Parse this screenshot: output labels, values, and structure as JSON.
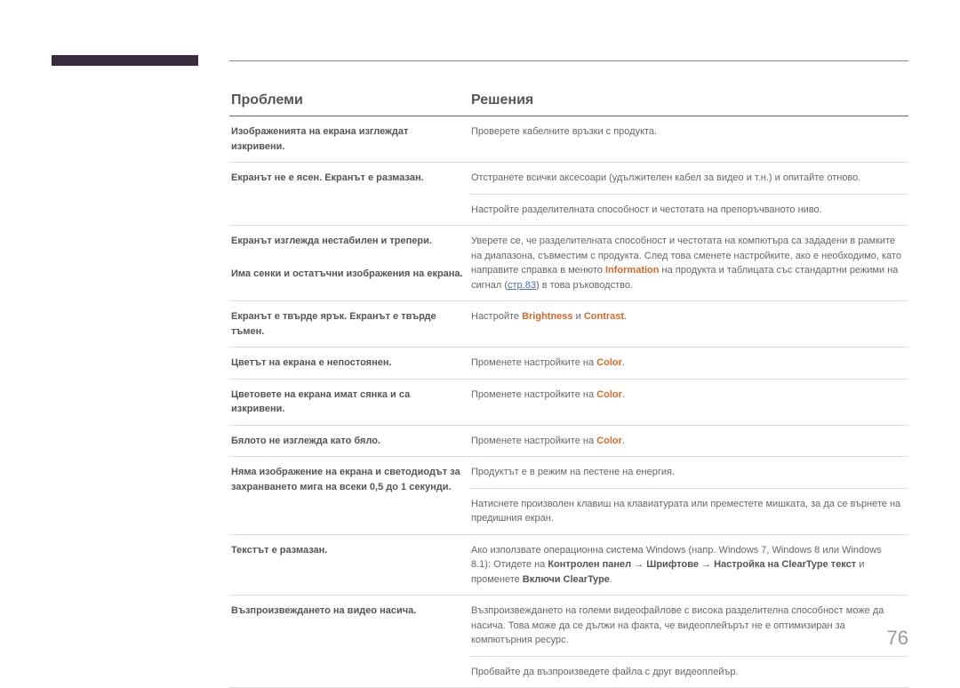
{
  "page_number": "76",
  "headers": {
    "problem": "Проблеми",
    "solution": "Решения"
  },
  "page_ref": {
    "prefix": "стр.",
    "num": "83"
  },
  "hl": {
    "information": "Information",
    "brightness": "Brightness",
    "contrast": "Contrast",
    "color": "Color"
  },
  "bold": {
    "control_panel": "Контролен панел",
    "fonts": "Шрифтове",
    "cleartype_setting": "Настройка на ClearType текст",
    "enable_cleartype": "Включи ClearType"
  },
  "rows": {
    "r1": {
      "p": "Изображенията на екрана изглеждат изкривени.",
      "s": "Проверете кабелните връзки с продукта."
    },
    "r2": {
      "p": "Екранът не е ясен. Екранът е размазан.",
      "s": "Отстранете всички аксесоари (удължителен кабел за видео и т.н.) и опитайте отново."
    },
    "r2b": {
      "s": "Настройте разделителната способност и честотата на препоръчваното ниво."
    },
    "r3a": {
      "p": "Екранът изглежда нестабилен и трепери."
    },
    "r3b": {
      "p": "Има сенки и остатъчни изображения на екрана."
    },
    "r3s": {
      "s1": "Уверете се, че разделителната способност и честотата на компютъра са зададени в рамките на диапазона, съвместим с продукта. След това сменете настройките, ако е необходимо, като направите справка в менюто ",
      "s2": " на продукта и таблицата със стандартни режими на сигнал (",
      "s3": ") в това ръководство."
    },
    "r4": {
      "p": "Екранът е твърде ярък. Екранът е твърде тъмен.",
      "s1": "Настройте ",
      "s2": " и ",
      "s3": "."
    },
    "r5": {
      "p": "Цветът на екрана е непостоянен.",
      "s1": "Променете настройките на ",
      "s2": "."
    },
    "r6": {
      "p": "Цветовете на екрана имат сянка и са изкривени.",
      "s1": "Променете настройките на ",
      "s2": "."
    },
    "r7": {
      "p": "Бялото не изглежда като бяло.",
      "s1": "Променете настройките на ",
      "s2": "."
    },
    "r8": {
      "p": "Няма изображение на екрана и светодиодът за захранването мига на всеки 0,5 до 1 секунди.",
      "s": "Продуктът е в режим на пестене на енергия."
    },
    "r8b": {
      "s": "Натиснете произволен клавиш на клавиатурата или преместете мишката, за да се върнете на предишния екран."
    },
    "r9": {
      "p": "Текстът е размазан.",
      "s1": "Ако използвате операционна система Windows (напр. Windows 7, Windows 8 или Windows 8.1): Отидете на ",
      "arrow": " → ",
      "s2": " и променете ",
      "s3": "."
    },
    "r10": {
      "p": "Възпроизвеждането на видео насича.",
      "s": "Възпроизвеждането на големи видеофайлове с висока разделителна способност може да насича. Това може да се дължи на факта, че видеоплейърът не е оптимизиран за компютърния ресурс."
    },
    "r10b": {
      "s": "Пробвайте да възпроизведете файла с друг видеоплейър."
    }
  }
}
